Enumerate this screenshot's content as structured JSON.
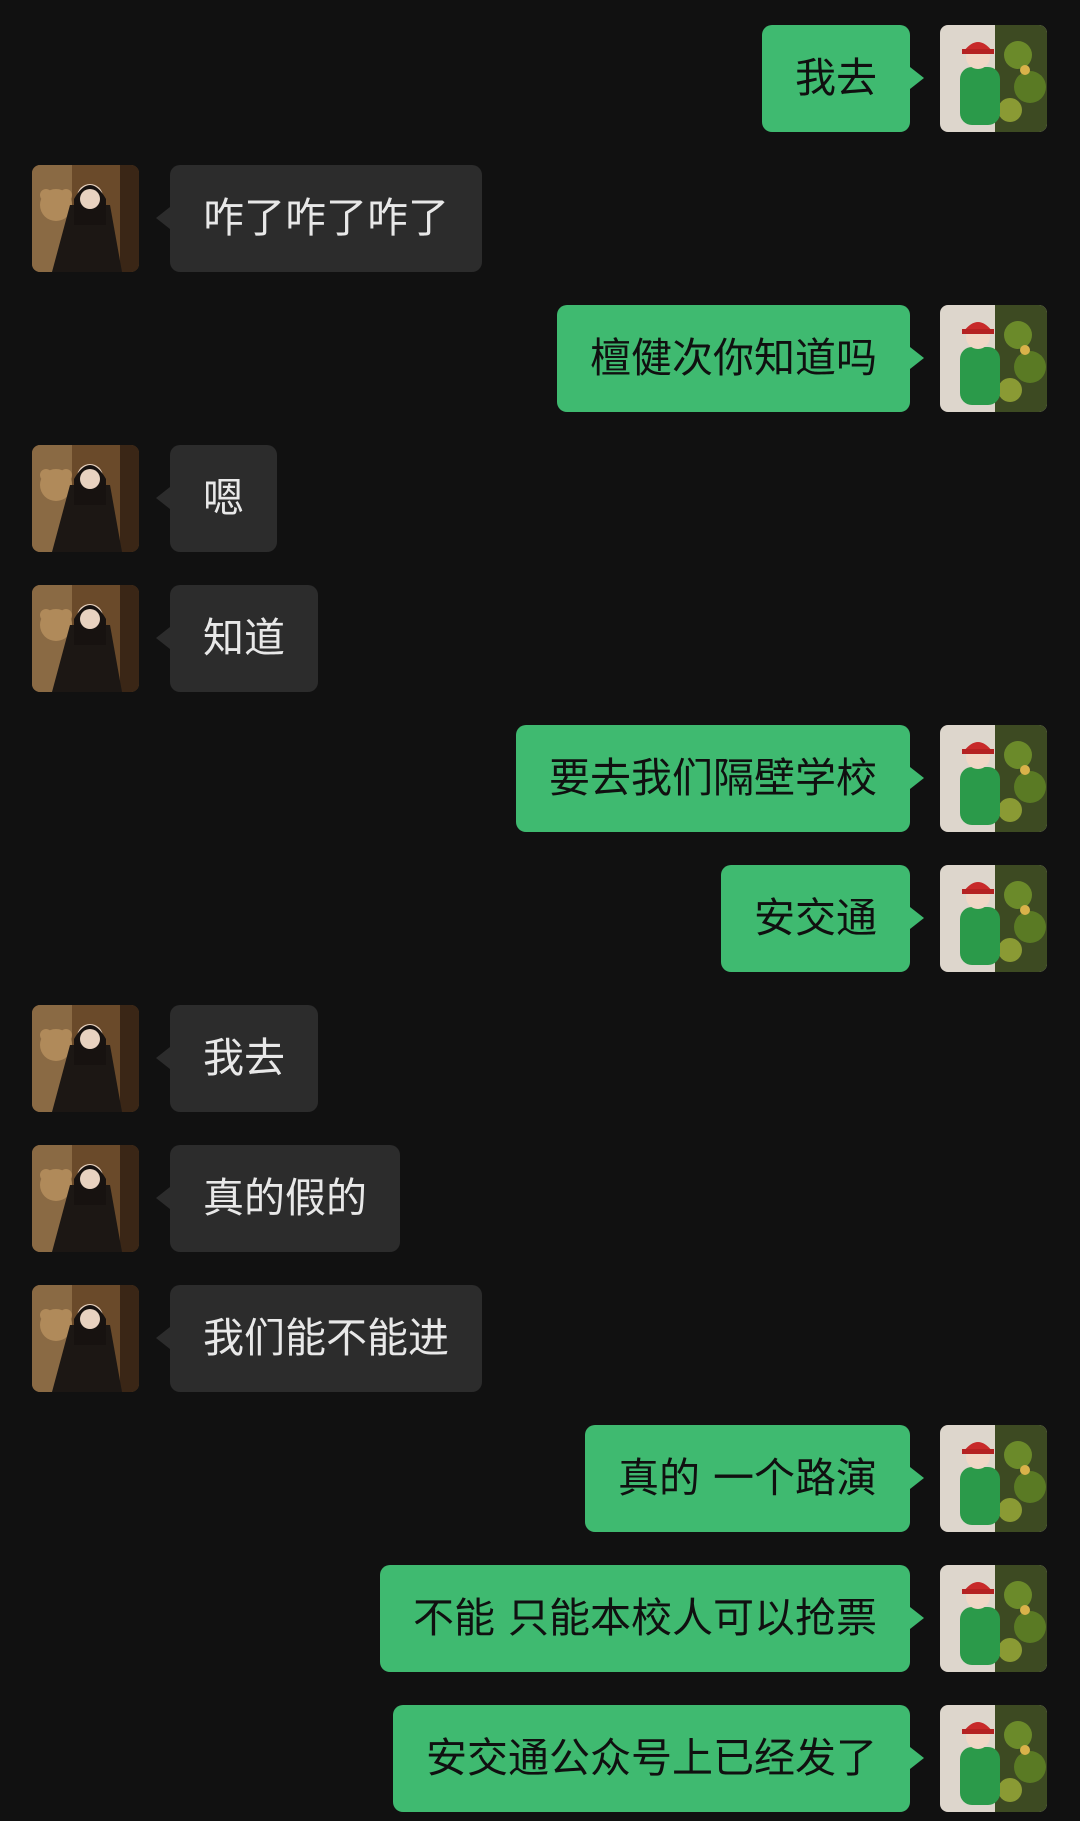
{
  "chat": {
    "messages": [
      {
        "side": "right",
        "text": "我去"
      },
      {
        "side": "left",
        "text": "咋了咋了咋了"
      },
      {
        "side": "right",
        "text": "檀健次你知道吗"
      },
      {
        "side": "left",
        "text": "嗯"
      },
      {
        "side": "left",
        "text": "知道"
      },
      {
        "side": "right",
        "text": "要去我们隔壁学校"
      },
      {
        "side": "right",
        "text": "安交通"
      },
      {
        "side": "left",
        "text": "我去"
      },
      {
        "side": "left",
        "text": "真的假的"
      },
      {
        "side": "left",
        "text": "我们能不能进"
      },
      {
        "side": "right",
        "text": "真的 一个路演"
      },
      {
        "side": "right",
        "text": "不能 只能本校人可以抢票"
      },
      {
        "side": "right",
        "text": "安交通公众号上已经发了"
      }
    ]
  },
  "colors": {
    "background": "#111111",
    "outgoing_bubble": "#3fba70",
    "incoming_bubble": "#2c2c2c"
  }
}
